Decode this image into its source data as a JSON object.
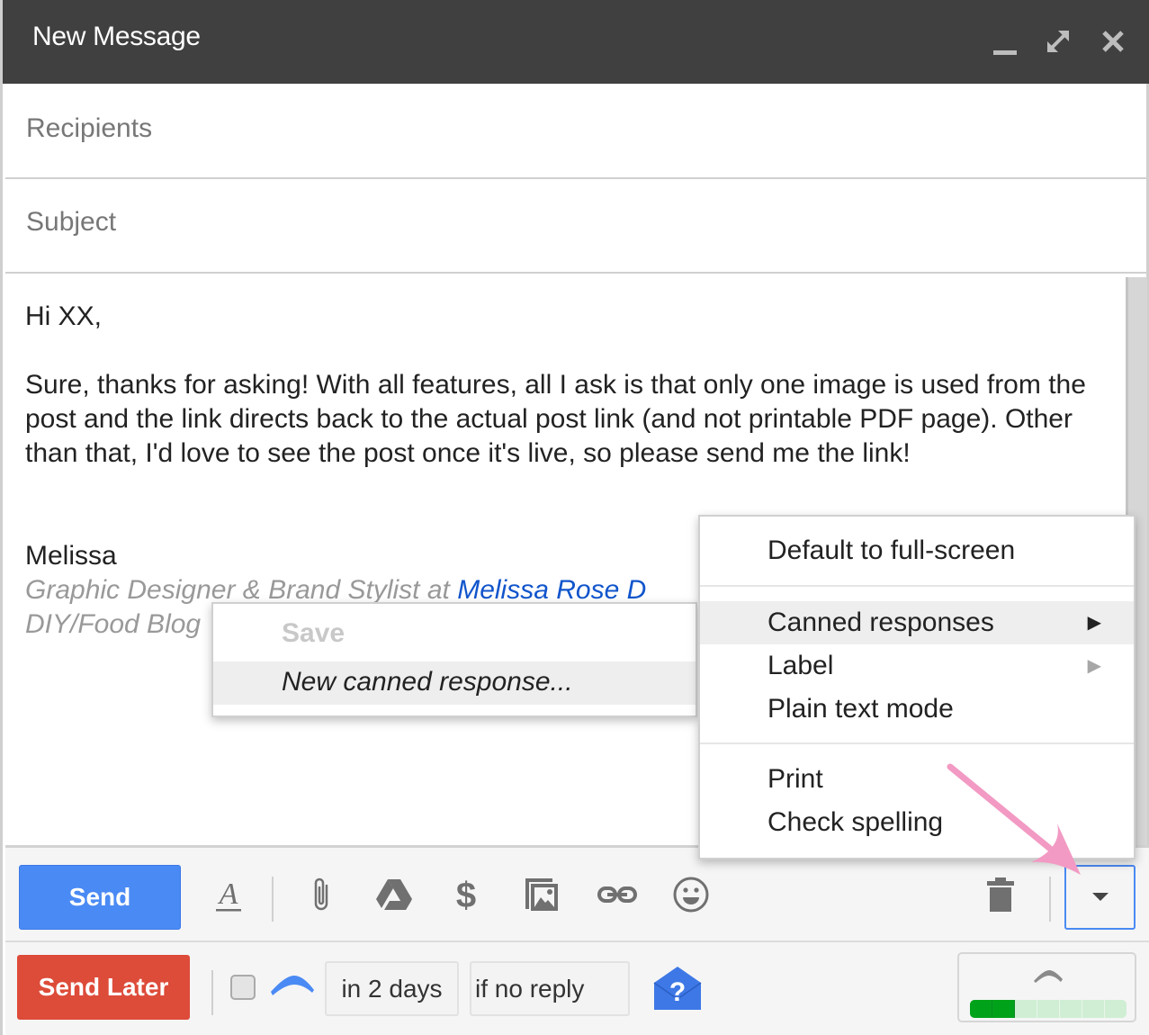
{
  "window": {
    "title": "New Message",
    "controls": {
      "minimize": "minimize-icon",
      "expand": "expand-icon",
      "close": "close-icon"
    }
  },
  "fields": {
    "recipients_placeholder": "Recipients",
    "subject_placeholder": "Subject"
  },
  "body": {
    "greeting": "Hi XX,",
    "paragraph": "Sure, thanks for asking! With all features, all I ask is that only one image is used from the post and the link directs back to the actual post link (and not printable PDF page). Other than that, I'd love to see the post once it's live, so please send me the link!",
    "signature_name": "Melissa",
    "signature_title_prefix": "Graphic Designer & Brand Stylist at ",
    "signature_link": "Melissa Rose D",
    "signature_line2": "DIY/Food Blog"
  },
  "toolbar": {
    "send_label": "Send",
    "icons": [
      "formatting-icon",
      "attach-icon",
      "drive-icon",
      "money-icon",
      "photo-icon",
      "link-icon",
      "emoji-icon",
      "trash-icon",
      "more-options-icon"
    ]
  },
  "send_later": {
    "button_label": "Send Later",
    "checked": false,
    "delay_value": "in 2 days",
    "condition_value": "if no reply",
    "progress": {
      "filled_segments": 2,
      "total_segments": 7
    }
  },
  "main_menu": {
    "items": [
      {
        "label": "Default to full-screen",
        "submenu": false
      },
      {
        "label": "Canned responses",
        "submenu": true,
        "highlighted": true
      },
      {
        "label": "Label",
        "submenu": true,
        "submenu_disabled_arrow": true
      },
      {
        "label": "Plain text mode",
        "submenu": false
      },
      {
        "label": "Print",
        "submenu": false
      },
      {
        "label": "Check spelling",
        "submenu": false
      }
    ],
    "arrow_glyph": "▶"
  },
  "canned_submenu": {
    "save_header": "Save",
    "new_item": "New canned response..."
  },
  "colors": {
    "header_bg": "#404040",
    "send_blue": "#4a8af4",
    "send_later_red": "#dd4b39",
    "link_blue": "#1155cc",
    "annotation_pink": "#f29ac3",
    "progress_green": "#00a21a"
  }
}
